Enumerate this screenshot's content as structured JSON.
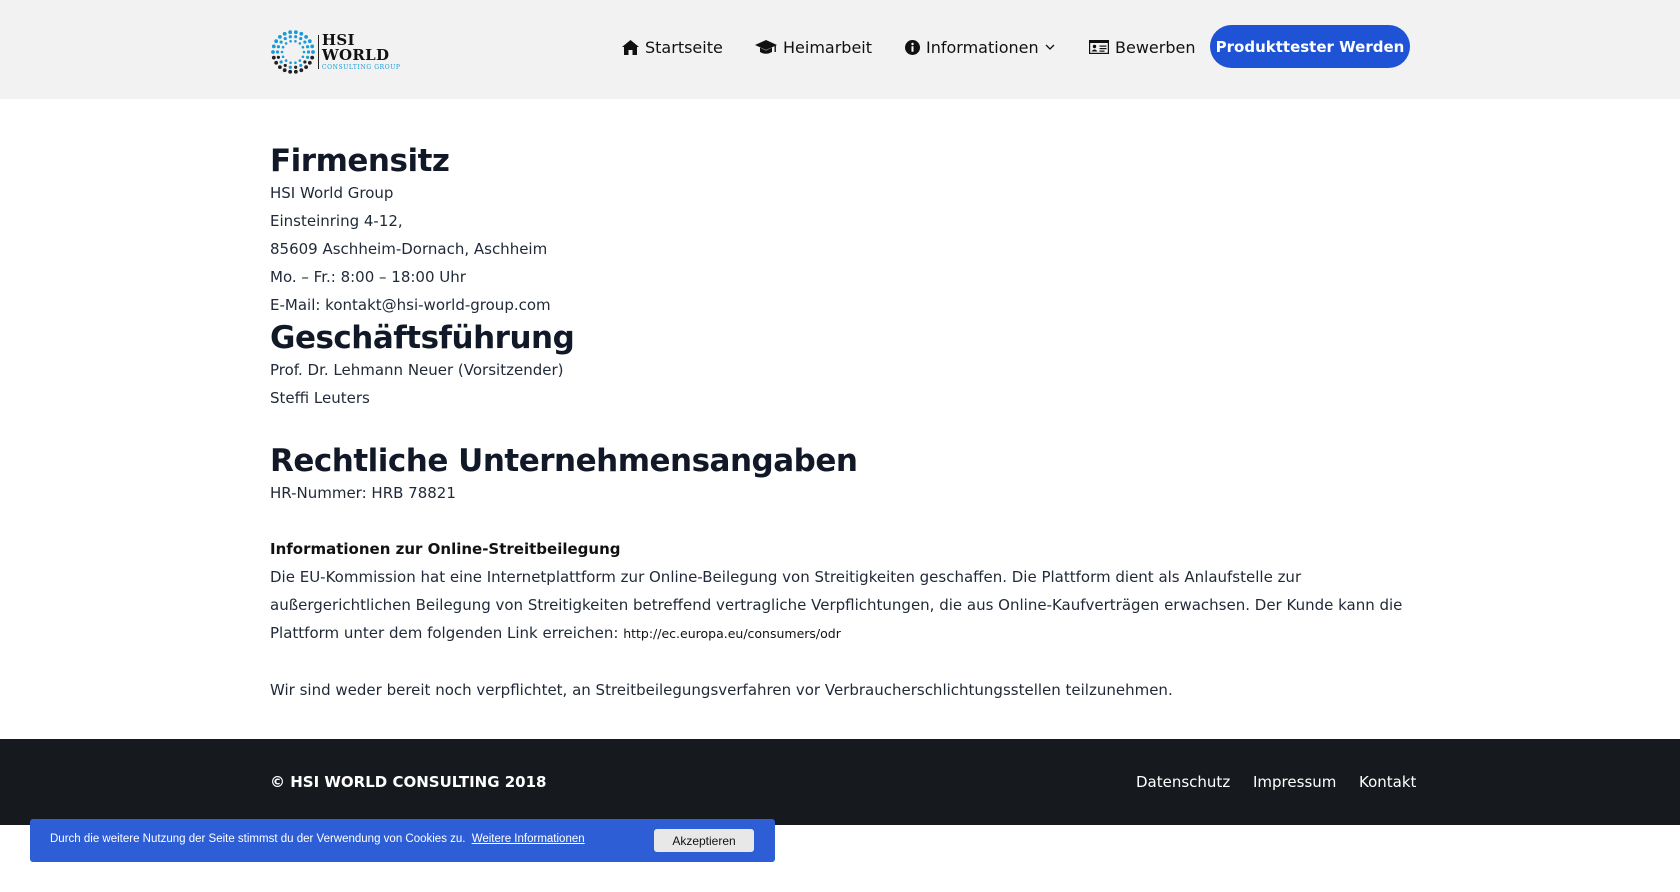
{
  "header": {
    "logo": {
      "title": "HSI WORLD",
      "subtitle": "CONSULTING GROUP"
    },
    "nav": [
      {
        "label": "Startseite",
        "icon": "home-icon"
      },
      {
        "label": "Heimarbeit",
        "icon": "graduation-cap-icon"
      },
      {
        "label": "Informationen",
        "icon": "info-circle-icon",
        "dropdown": true
      },
      {
        "label": "Bewerben",
        "icon": "id-card-icon"
      }
    ],
    "cta_label": "Produkttester Werden"
  },
  "main": {
    "firmensitz": {
      "heading": "Firmensitz",
      "lines": [
        "HSI World Group",
        "Einsteinring 4-12,",
        "85609 Aschheim-Dornach, Aschheim",
        "Mo. – Fr.: 8:00 – 18:00 Uhr",
        "E-Mail: kontakt@hsi-world-group.com"
      ]
    },
    "geschaeftsfuehrung": {
      "heading": "Geschäftsführung",
      "lines": [
        "Prof. Dr. Lehmann Neuer (Vorsitzender)",
        "Steffi Leuters"
      ]
    },
    "rechtliche": {
      "heading": "Rechtliche Unternehmensangaben",
      "hr": "HR-Nummer: HRB 78821",
      "odr_title": "Informationen zur Online-Streitbeilegung",
      "odr_text": "Die EU-Kommission hat eine Internetplattform zur Online-Beilegung von Streitigkeiten geschaffen. Die Plattform dient als Anlaufstelle zur außergerichtlichen Beilegung von Streitigkeiten betreffend vertragliche Verpflichtungen, die aus Online-Kaufverträgen erwachsen. Der Kunde kann die Plattform unter dem folgenden Link erreichen:",
      "odr_link": "http://ec.europa.eu/consumers/odr",
      "closing": "Wir sind weder bereit noch verpflichtet, an Streitbeilegungsverfahren vor Verbraucherschlichtungsstellen teilzunehmen."
    }
  },
  "footer": {
    "copyright": "© HSI WORLD CONSULTING 2018",
    "links": [
      "Datenschutz",
      "Impressum",
      "Kontakt"
    ]
  },
  "cookie": {
    "text": "Durch die weitere Nutzung der Seite stimmst du der Verwendung von Cookies zu.",
    "more_label": "Weitere Informationen",
    "accept_label": "Akzeptieren"
  },
  "colors": {
    "accent": "#1e53d6",
    "header_bg": "#f2f2f2",
    "footer_bg": "#16191d",
    "cookie_bg": "#2d5ed6",
    "logo_accent": "#1a9bd8"
  }
}
